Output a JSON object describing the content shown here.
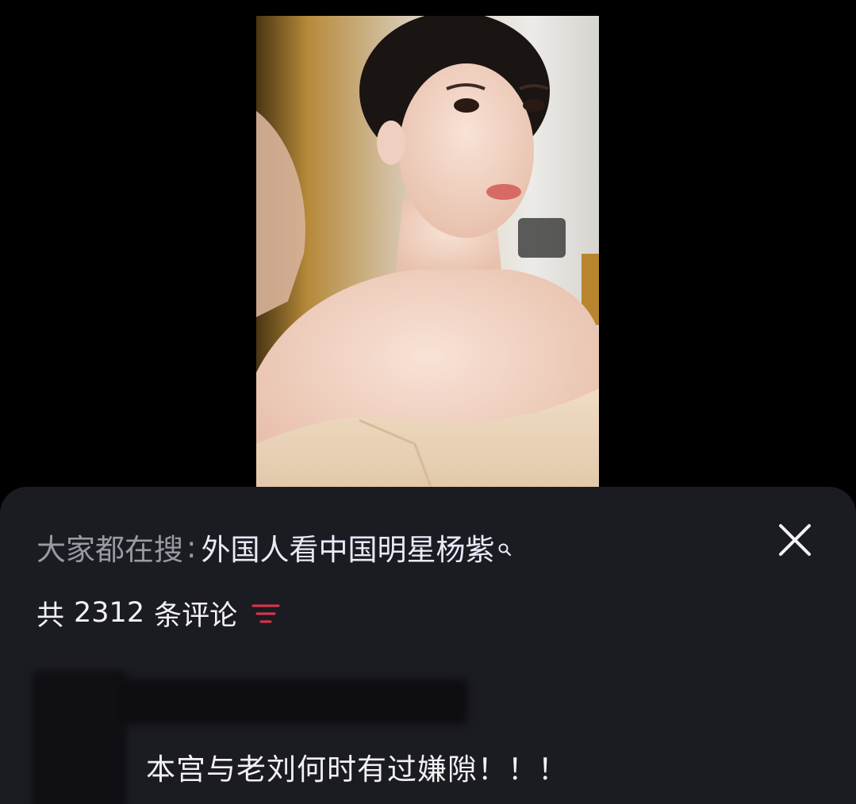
{
  "search_hint": {
    "prefix": "大家都在搜",
    "colon": ":",
    "term": "外国人看中国明星杨紫"
  },
  "comments_header": {
    "prefix": "共",
    "count": "2312",
    "suffix": "条评论"
  },
  "comment": {
    "text": "本宫与老刘何时有过嫌隙！！！"
  },
  "icons": {
    "close": "close-icon",
    "filter": "filter-icon",
    "search": "search-icon"
  },
  "colors": {
    "sheet_bg": "#1b1b22",
    "filter_accent": "#e0344a",
    "search_term": "#e6ebf7",
    "muted_text": "#9a9aa3"
  }
}
